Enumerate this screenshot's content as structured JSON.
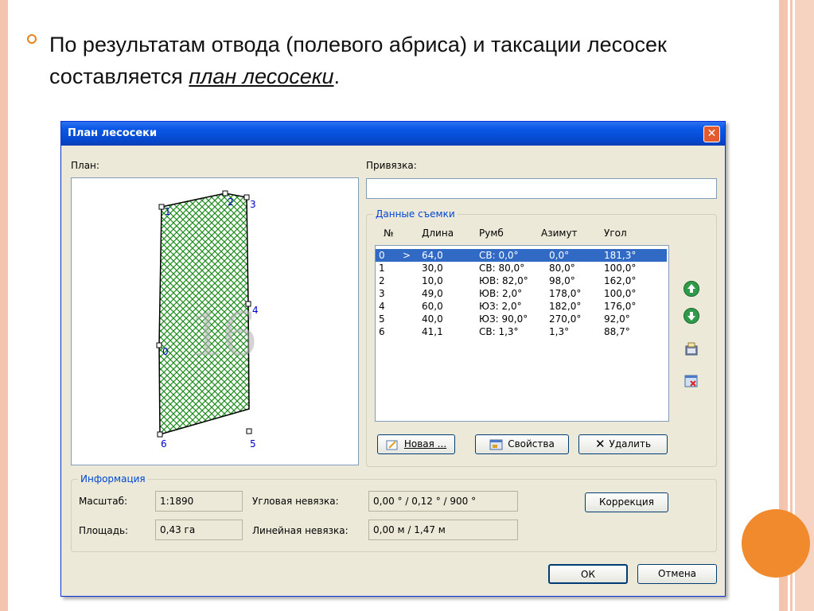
{
  "slide": {
    "text_before": "По результатам отвода (полевого абриса) и таксации лесосек составляется ",
    "text_emph": "план лесосеки",
    "text_after": "."
  },
  "dialog": {
    "title": "План лесосеки",
    "close_glyph": "✕",
    "plan_label": "План:",
    "binding_label": "Привязка:",
    "binding_value": "",
    "survey_group_title": "Данные съемки",
    "columns": [
      "№",
      "Длина",
      "Румб",
      "Азимут",
      "Угол"
    ],
    "rows": [
      {
        "n": "0",
        "mark": ">",
        "len": "64,0",
        "rumb": "СВ: 0,0°",
        "az": "0,0°",
        "ang": "181,3°",
        "selected": true
      },
      {
        "n": "1",
        "mark": "",
        "len": "30,0",
        "rumb": "СВ: 80,0°",
        "az": "80,0°",
        "ang": "100,0°",
        "selected": false
      },
      {
        "n": "2",
        "mark": "",
        "len": "10,0",
        "rumb": "ЮВ: 82,0°",
        "az": "98,0°",
        "ang": "162,0°",
        "selected": false
      },
      {
        "n": "3",
        "mark": "",
        "len": "49,0",
        "rumb": "ЮВ: 2,0°",
        "az": "178,0°",
        "ang": "100,0°",
        "selected": false
      },
      {
        "n": "4",
        "mark": "",
        "len": "60,0",
        "rumb": "ЮЗ: 2,0°",
        "az": "182,0°",
        "ang": "176,0°",
        "selected": false
      },
      {
        "n": "5",
        "mark": "",
        "len": "40,0",
        "rumb": "ЮЗ: 90,0°",
        "az": "270,0°",
        "ang": "92,0°",
        "selected": false
      },
      {
        "n": "6",
        "mark": "",
        "len": "41,1",
        "rumb": "СВ: 1,3°",
        "az": "1,3°",
        "ang": "88,7°",
        "selected": false
      }
    ],
    "plan_points": [
      "1",
      "2",
      "3",
      "4",
      "0",
      "6",
      "5"
    ],
    "plan_watermark": "16",
    "side_buttons": {
      "up": "arrow-up-icon",
      "down": "arrow-down-icon",
      "props": "edit-point-icon",
      "delete": "delete-point-icon"
    },
    "buttons": {
      "new": "Новая ...",
      "props": "Свойства",
      "delete": "Удалить"
    },
    "info_group_title": "Информация",
    "info": {
      "scale_label": "Масштаб:",
      "scale_value": "1:1890",
      "area_label": "Площадь:",
      "area_value": "0,43 га",
      "ang_label": "Угловая невязка:",
      "ang_value": "0,00 ° / 0,12 ° / 900 °",
      "lin_label": "Линейная невязка:",
      "lin_value": "0,00 м / 1,47 м"
    },
    "correction_button": "Коррекция",
    "ok_button": "ОК",
    "cancel_button": "Отмена"
  },
  "colors": {
    "titlebar": "#0a58e6",
    "selection": "#316ac5",
    "accent": "#f08a2c",
    "hatch": "#1e8c1e"
  }
}
